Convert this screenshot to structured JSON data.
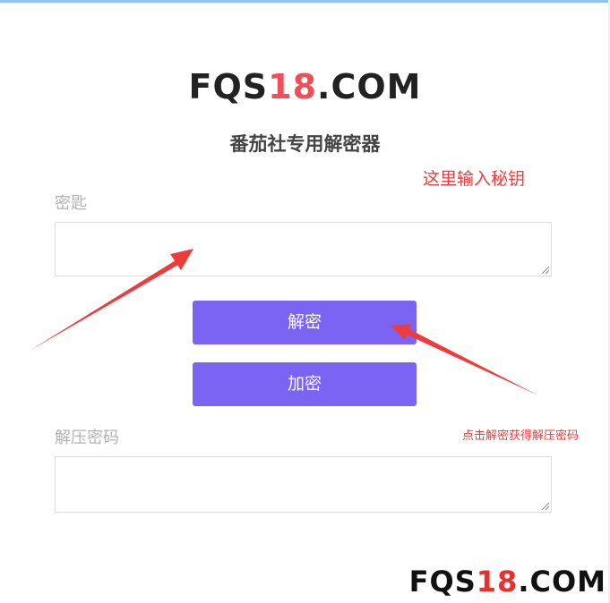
{
  "logo": {
    "prefix": "FQS",
    "number": "18",
    "suffix": ".COM"
  },
  "subtitle": "番茄社专用解密器",
  "key_field": {
    "label": "密匙",
    "value": ""
  },
  "buttons": {
    "decrypt": "解密",
    "encrypt": "加密"
  },
  "password_field": {
    "label": "解压密码",
    "value": ""
  },
  "annotations": {
    "key_hint": "这里输入秘钥",
    "decrypt_hint": "点击解密获得解压密码"
  },
  "watermark": {
    "prefix": "FQS",
    "number": "18",
    "suffix": ".COM"
  },
  "colors": {
    "button": "#7b64f2",
    "logo_accent": "#f04f5a",
    "annotation": "#ee3b3b"
  }
}
